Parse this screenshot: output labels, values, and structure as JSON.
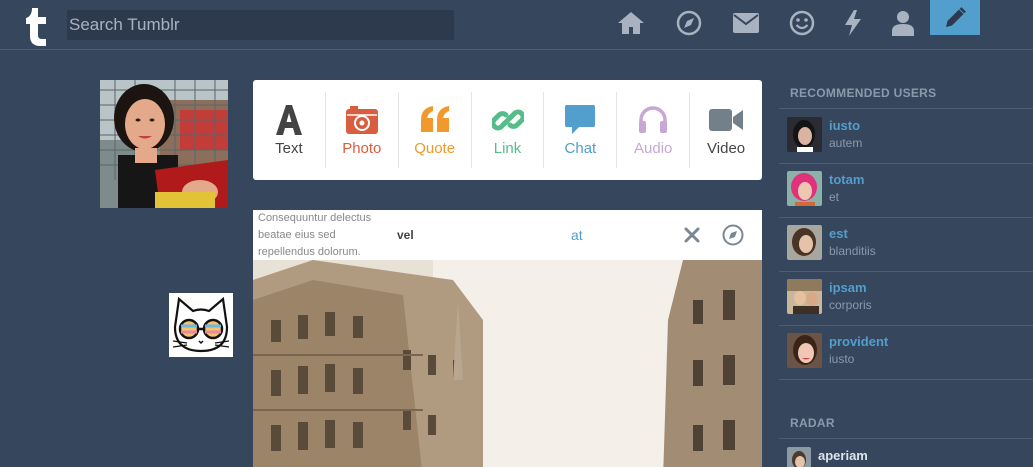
{
  "header": {
    "search_placeholder": "Search Tumblr",
    "accent": "#529ecc",
    "nav_icons": [
      "home-icon",
      "compass-icon",
      "mail-icon",
      "smiley-icon",
      "lightning-icon",
      "user-icon"
    ],
    "compose_icon": "pencil-icon"
  },
  "post_types": [
    {
      "label": "Text",
      "icon": "text-icon",
      "color": "#444444"
    },
    {
      "label": "Photo",
      "icon": "camera-icon",
      "color": "#d95e40"
    },
    {
      "label": "Quote",
      "icon": "quote-icon",
      "color": "#f2992e"
    },
    {
      "label": "Link",
      "icon": "link-icon",
      "color": "#56bc8a"
    },
    {
      "label": "Chat",
      "icon": "chat-icon",
      "color": "#529ecc"
    },
    {
      "label": "Audio",
      "icon": "headphones-icon",
      "color": "#c9a6d8"
    },
    {
      "label": "Video",
      "icon": "video-icon",
      "color": "#748089"
    }
  ],
  "post": {
    "description": "Consequuntur delectus beatae eius sed repellendus dolorum.",
    "tag": "vel",
    "link": "at"
  },
  "sidebar": {
    "recommended_title": "RECOMMENDED USERS",
    "users": [
      {
        "name": "iusto",
        "sub": "autem"
      },
      {
        "name": "totam",
        "sub": "et"
      },
      {
        "name": "est",
        "sub": "blanditiis"
      },
      {
        "name": "ipsam",
        "sub": "corporis"
      },
      {
        "name": "provident",
        "sub": "iusto"
      }
    ],
    "radar_title": "RADAR",
    "radar_user": "aperiam"
  }
}
